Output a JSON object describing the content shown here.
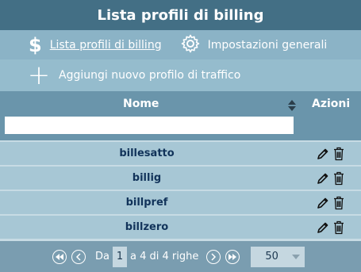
{
  "header": {
    "title": "Lista profili di billing"
  },
  "nav": {
    "profiles_link": "Lista profili di billing",
    "settings_link": "Impostazioni generali",
    "dollar_icon": "$"
  },
  "add": {
    "label": "Aggiungi nuovo profilo di traffico",
    "plus": "+"
  },
  "table": {
    "columns": {
      "name": "Nome",
      "actions": "Azioni"
    },
    "filter": {
      "value": "",
      "placeholder": ""
    },
    "rows": [
      {
        "name": "billesatto"
      },
      {
        "name": "billig"
      },
      {
        "name": "billpref"
      },
      {
        "name": "billzero"
      }
    ]
  },
  "pager": {
    "prefix": "Da",
    "current_page": "1",
    "suffix": "a 4 di 4 righe",
    "page_size": "50"
  },
  "colors": {
    "title_bg": "#436f85",
    "nav_bg": "#8bb3c6",
    "row_bg": "#a7c7d5",
    "row_text": "#11335a"
  }
}
